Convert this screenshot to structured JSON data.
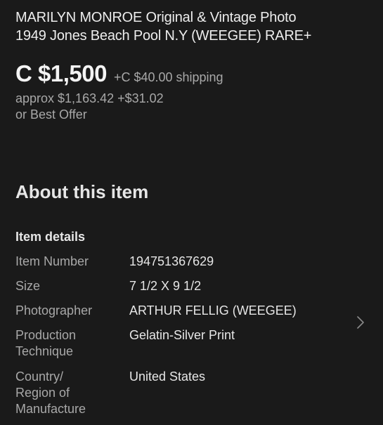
{
  "listing": {
    "title_line1": "MARILYN MONROE Original & Vintage Photo",
    "title_line2": "1949 Jones Beach Pool N.Y (WEEGEE) RARE+",
    "price": "C $1,500",
    "shipping": "+C $40.00 shipping",
    "approx": "approx $1,163.42 +$31.02",
    "best_offer": "or Best Offer"
  },
  "about": {
    "heading": "About this item",
    "details_heading": "Item details",
    "specs": [
      {
        "label": "Item Number",
        "value": "194751367629"
      },
      {
        "label": "Size",
        "value": "7 1/2 X 9 1/2"
      },
      {
        "label": "Photographer",
        "value": "ARTHUR FELLIG (WEEGEE)"
      },
      {
        "label_line1": "Production",
        "label_line2": "Technique",
        "value": "Gelatin-Silver Print"
      },
      {
        "label_line1": "Country/",
        "label_line2": "Region of",
        "label_line3": "Manufacture",
        "value": "United States"
      }
    ]
  },
  "icons": {
    "chevron": "chevron-right-icon"
  },
  "colors": {
    "background": "#1a1a1a",
    "primary_text": "#e8e8e8",
    "secondary_text": "#a8a8a8"
  }
}
